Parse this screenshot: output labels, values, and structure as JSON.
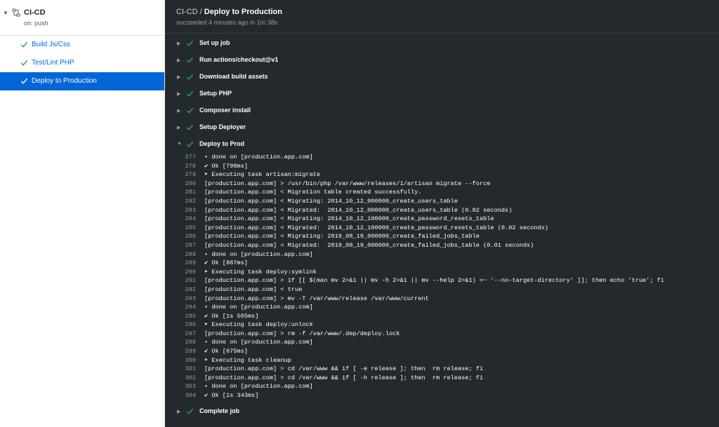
{
  "sidebar": {
    "workflow_name": "CI-CD",
    "workflow_trigger": "on: push",
    "jobs": [
      {
        "label": "Build Js/Css"
      },
      {
        "label": "Test/Lint PHP"
      },
      {
        "label": "Deploy to Production"
      }
    ]
  },
  "header": {
    "workflow": "CI-CD",
    "separator": "/",
    "job": "Deploy to Production",
    "status": "succeeded 4 minutes ago in 1m 38s"
  },
  "steps": [
    {
      "name": "Set up job"
    },
    {
      "name": "Run actions/checkout@v1"
    },
    {
      "name": "Download build assets"
    },
    {
      "name": "Setup PHP"
    },
    {
      "name": "Composer install"
    },
    {
      "name": "Setup Deployer"
    },
    {
      "name": "Deploy to Prod"
    }
  ],
  "final_step": {
    "name": "Complete job"
  },
  "log_lines": [
    {
      "n": "277",
      "t": "• done on [production.app.com]"
    },
    {
      "n": "278",
      "t": "✔ Ok [798ms]"
    },
    {
      "n": "279",
      "t": "➤ Executing task artisan:migrate"
    },
    {
      "n": "280",
      "t": "[production.app.com] > /usr/bin/php /var/www/releases/1/artisan migrate --force"
    },
    {
      "n": "281",
      "t": "[production.app.com] < Migration table created successfully."
    },
    {
      "n": "282",
      "t": "[production.app.com] < Migrating: 2014_10_12_000000_create_users_table"
    },
    {
      "n": "283",
      "t": "[production.app.com] < Migrated:  2014_10_12_000000_create_users_table (0.02 seconds)"
    },
    {
      "n": "284",
      "t": "[production.app.com] < Migrating: 2014_10_12_100000_create_password_resets_table"
    },
    {
      "n": "285",
      "t": "[production.app.com] < Migrated:  2014_10_12_100000_create_password_resets_table (0.02 seconds)"
    },
    {
      "n": "286",
      "t": "[production.app.com] < Migrating: 2019_08_19_000000_create_failed_jobs_table"
    },
    {
      "n": "287",
      "t": "[production.app.com] < Migrated:  2019_08_19_000000_create_failed_jobs_table (0.01 seconds)"
    },
    {
      "n": "288",
      "t": "• done on [production.app.com]"
    },
    {
      "n": "289",
      "t": "✔ Ok [887ms]"
    },
    {
      "n": "290",
      "t": "➤ Executing task deploy:symlink"
    },
    {
      "n": "291",
      "t": "[production.app.com] > if [[ $(man mv 2>&1 || mv -h 2>&1 || mv --help 2>&1) =~ '--no-target-directory' ]]; then echo 'true'; fi"
    },
    {
      "n": "292",
      "t": "[production.app.com] < true"
    },
    {
      "n": "293",
      "t": "[production.app.com] > mv -T /var/www/release /var/www/current"
    },
    {
      "n": "294",
      "t": "• done on [production.app.com]"
    },
    {
      "n": "295",
      "t": "✔ Ok [1s 505ms]"
    },
    {
      "n": "296",
      "t": "➤ Executing task deploy:unlock"
    },
    {
      "n": "297",
      "t": "[production.app.com] > rm -f /var/www/.dep/deploy.lock"
    },
    {
      "n": "298",
      "t": "• done on [production.app.com]"
    },
    {
      "n": "299",
      "t": "✔ Ok [675ms]"
    },
    {
      "n": "300",
      "t": "➤ Executing task cleanup"
    },
    {
      "n": "301",
      "t": "[production.app.com] > cd /var/www && if [ -e release ]; then  rm release; fi"
    },
    {
      "n": "302",
      "t": "[production.app.com] > cd /var/www && if [ -h release ]; then  rm release; fi"
    },
    {
      "n": "303",
      "t": "• done on [production.app.com]"
    },
    {
      "n": "304",
      "t": "✔ Ok [1s 343ms]"
    }
  ],
  "colors": {
    "accent": "#0366d6",
    "success": "#28a745",
    "log_bg": "#24292e"
  },
  "icons": {
    "workflow": "workflow-icon",
    "step_status": "check-icon",
    "expand": "caret-right-icon",
    "collapse": "caret-down-icon"
  }
}
